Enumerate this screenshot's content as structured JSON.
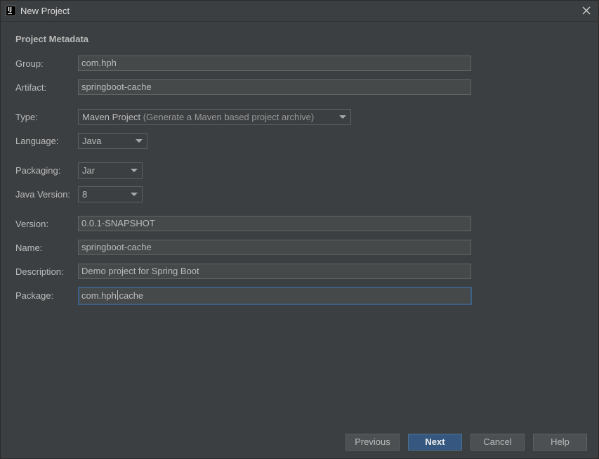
{
  "window": {
    "title": "New Project",
    "icon": "intellij-idea-icon",
    "icon_text": "IJ"
  },
  "section": {
    "title": "Project Metadata"
  },
  "fields": {
    "group": {
      "label": "Group:",
      "value": "com.hph"
    },
    "artifact": {
      "label": "Artifact:",
      "value": "springboot-cache"
    },
    "type": {
      "label": "Type:",
      "value": "Maven Project",
      "hint": "(Generate a Maven based project archive)"
    },
    "language": {
      "label": "Language:",
      "value": "Java"
    },
    "packaging": {
      "label": "Packaging:",
      "value": "Jar"
    },
    "java_version": {
      "label": "Java Version:",
      "value": "8"
    },
    "version": {
      "label": "Version:",
      "value": "0.0.1-SNAPSHOT"
    },
    "name": {
      "label": "Name:",
      "value": "springboot-cache"
    },
    "description": {
      "label": "Description:",
      "value": "Demo project for Spring Boot"
    },
    "package": {
      "label": "Package:",
      "value": "com.hph.cache"
    }
  },
  "buttons": {
    "previous": "Previous",
    "next": "Next",
    "cancel": "Cancel",
    "help": "Help"
  },
  "colors": {
    "background": "#3c3f41",
    "field_bg": "#45494a",
    "default_button": "#365880",
    "focus_border": "#3d6185"
  }
}
